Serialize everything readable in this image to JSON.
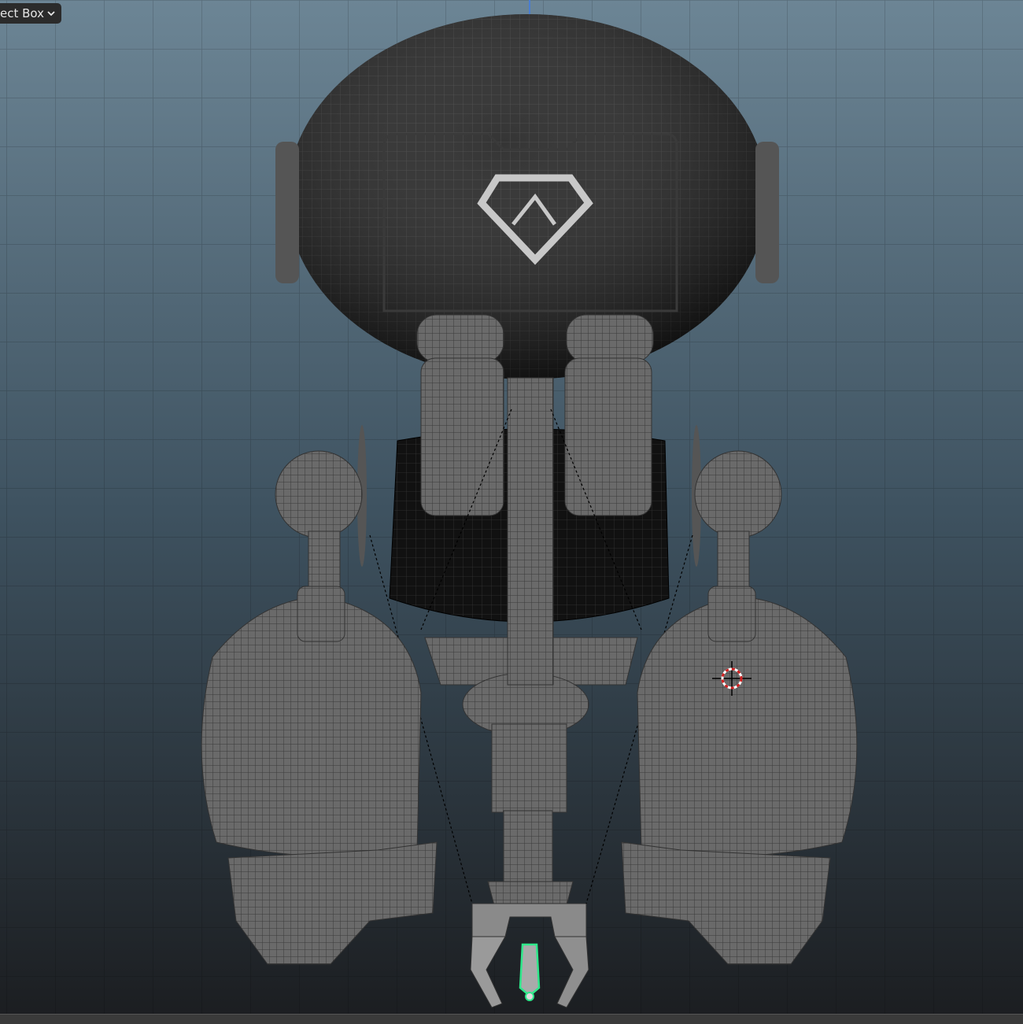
{
  "toolbar": {
    "select_mode_label": "ect Box",
    "select_mode_icon": "chevron-down-icon"
  },
  "viewport": {
    "background_top": "#6c8595",
    "background_bottom": "#1b1d20",
    "mesh_color": "#6e6e6e",
    "selection_color": "#2ee88a",
    "cursor_color": "#d02020",
    "logo_letter": "Λ"
  }
}
